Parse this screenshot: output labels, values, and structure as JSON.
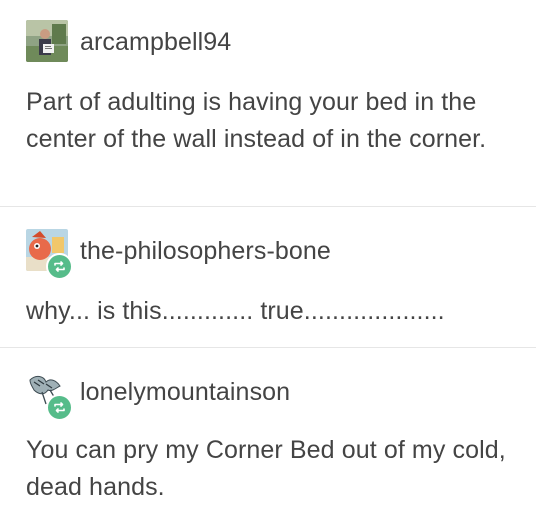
{
  "posts": [
    {
      "username": "arcampbell94",
      "avatar_icon": "person-photo-avatar",
      "text": "Part of adulting is having your bed in the center of the wall instead of in the corner.",
      "reblog": false
    },
    {
      "username": "the-philosophers-bone",
      "avatar_icon": "cartoon-character-avatar",
      "text": "why... is this............. true....................",
      "reblog": true
    },
    {
      "username": "lonelymountainson",
      "avatar_icon": "dragon-sketch-avatar",
      "text": "You can pry my Corner Bed out of my cold, dead hands.",
      "reblog": true
    }
  ],
  "colors": {
    "text": "#444444",
    "divider": "#e6e6e6",
    "reblog_badge": "#56bc8a"
  }
}
